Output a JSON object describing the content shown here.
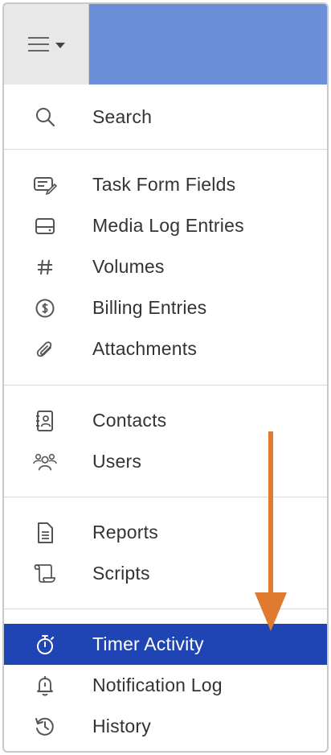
{
  "header": {
    "menu_icon": "hamburger-menu-icon",
    "dropdown_icon": "caret-down-icon",
    "accent_color": "#6b8fd9"
  },
  "menu": {
    "search": {
      "label": "Search",
      "icon": "search-icon"
    },
    "group1": [
      {
        "label": "Task Form Fields",
        "icon": "form-edit-icon"
      },
      {
        "label": "Media Log Entries",
        "icon": "media-drive-icon"
      },
      {
        "label": "Volumes",
        "icon": "hash-icon"
      },
      {
        "label": "Billing Entries",
        "icon": "dollar-circle-icon"
      },
      {
        "label": "Attachments",
        "icon": "paperclip-icon"
      }
    ],
    "group2": [
      {
        "label": "Contacts",
        "icon": "contact-card-icon"
      },
      {
        "label": "Users",
        "icon": "users-icon"
      }
    ],
    "group3": [
      {
        "label": "Reports",
        "icon": "document-icon"
      },
      {
        "label": "Scripts",
        "icon": "script-scroll-icon"
      }
    ],
    "group4": [
      {
        "label": "Timer Activity",
        "icon": "stopwatch-icon",
        "selected": true
      },
      {
        "label": "Notification Log",
        "icon": "bell-icon"
      },
      {
        "label": "History",
        "icon": "history-icon"
      }
    ],
    "active_color": "#1f45b5"
  },
  "annotation": {
    "icon": "down-arrow-icon",
    "color": "#e07a2e"
  }
}
